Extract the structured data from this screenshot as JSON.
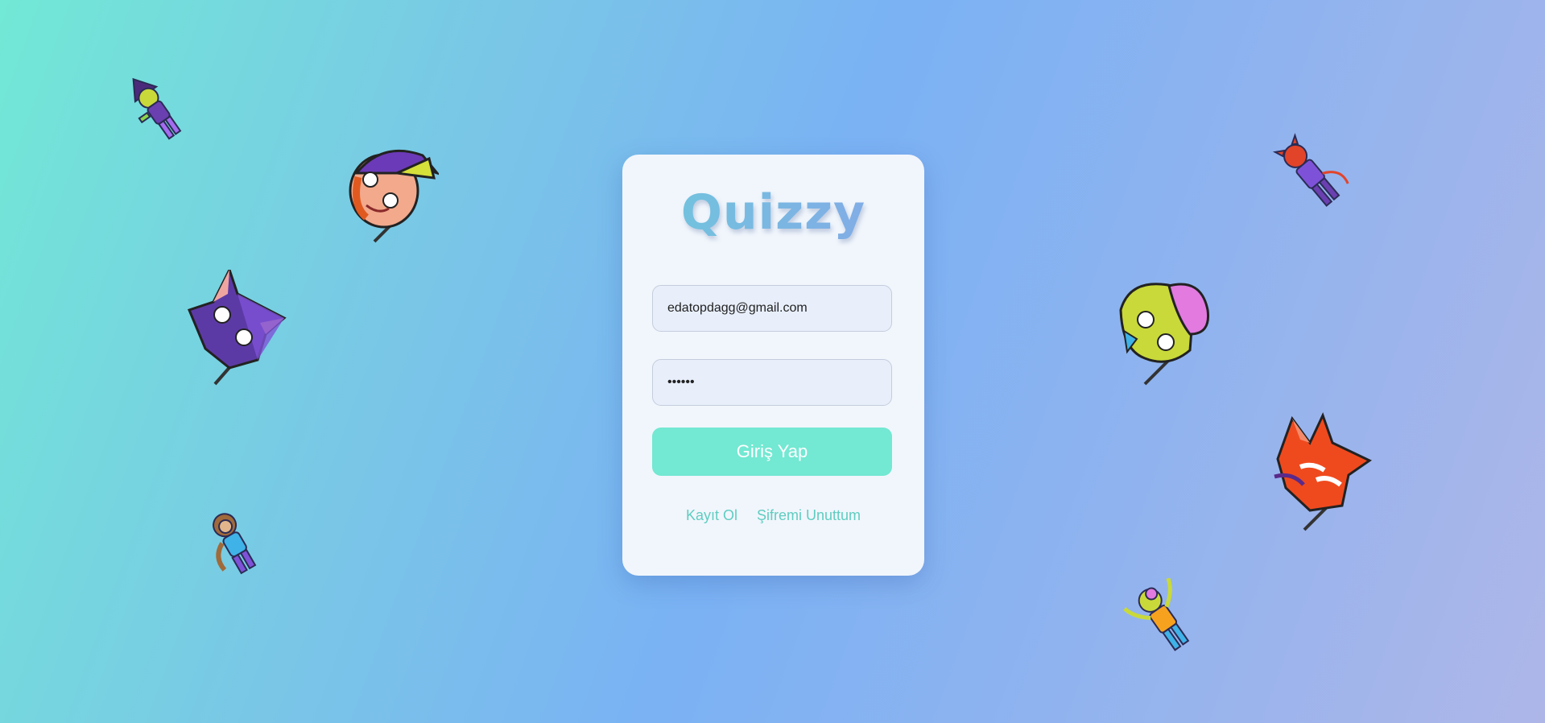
{
  "app": {
    "title": "Quizzy"
  },
  "form": {
    "email_value": "edatopdagg@gmail.com",
    "password_value": "••••••",
    "login_label": "Giriş Yap"
  },
  "links": {
    "register": "Kayıt Ol",
    "forgot": "Şifremi Unuttum"
  },
  "colors": {
    "bg_start": "#72e8d6",
    "bg_mid": "#7ab2f4",
    "bg_end": "#aeb6e8",
    "button": "#73e8d2",
    "link": "#5fcdc1",
    "card": "#f1f6fc"
  },
  "decorations": [
    {
      "name": "witch-girl-character-icon"
    },
    {
      "name": "witch-head-icon"
    },
    {
      "name": "purple-cat-mask-icon"
    },
    {
      "name": "monkey-character-icon"
    },
    {
      "name": "devil-character-icon"
    },
    {
      "name": "zombie-head-icon"
    },
    {
      "name": "red-devil-mask-icon"
    },
    {
      "name": "zombie-character-icon"
    }
  ]
}
